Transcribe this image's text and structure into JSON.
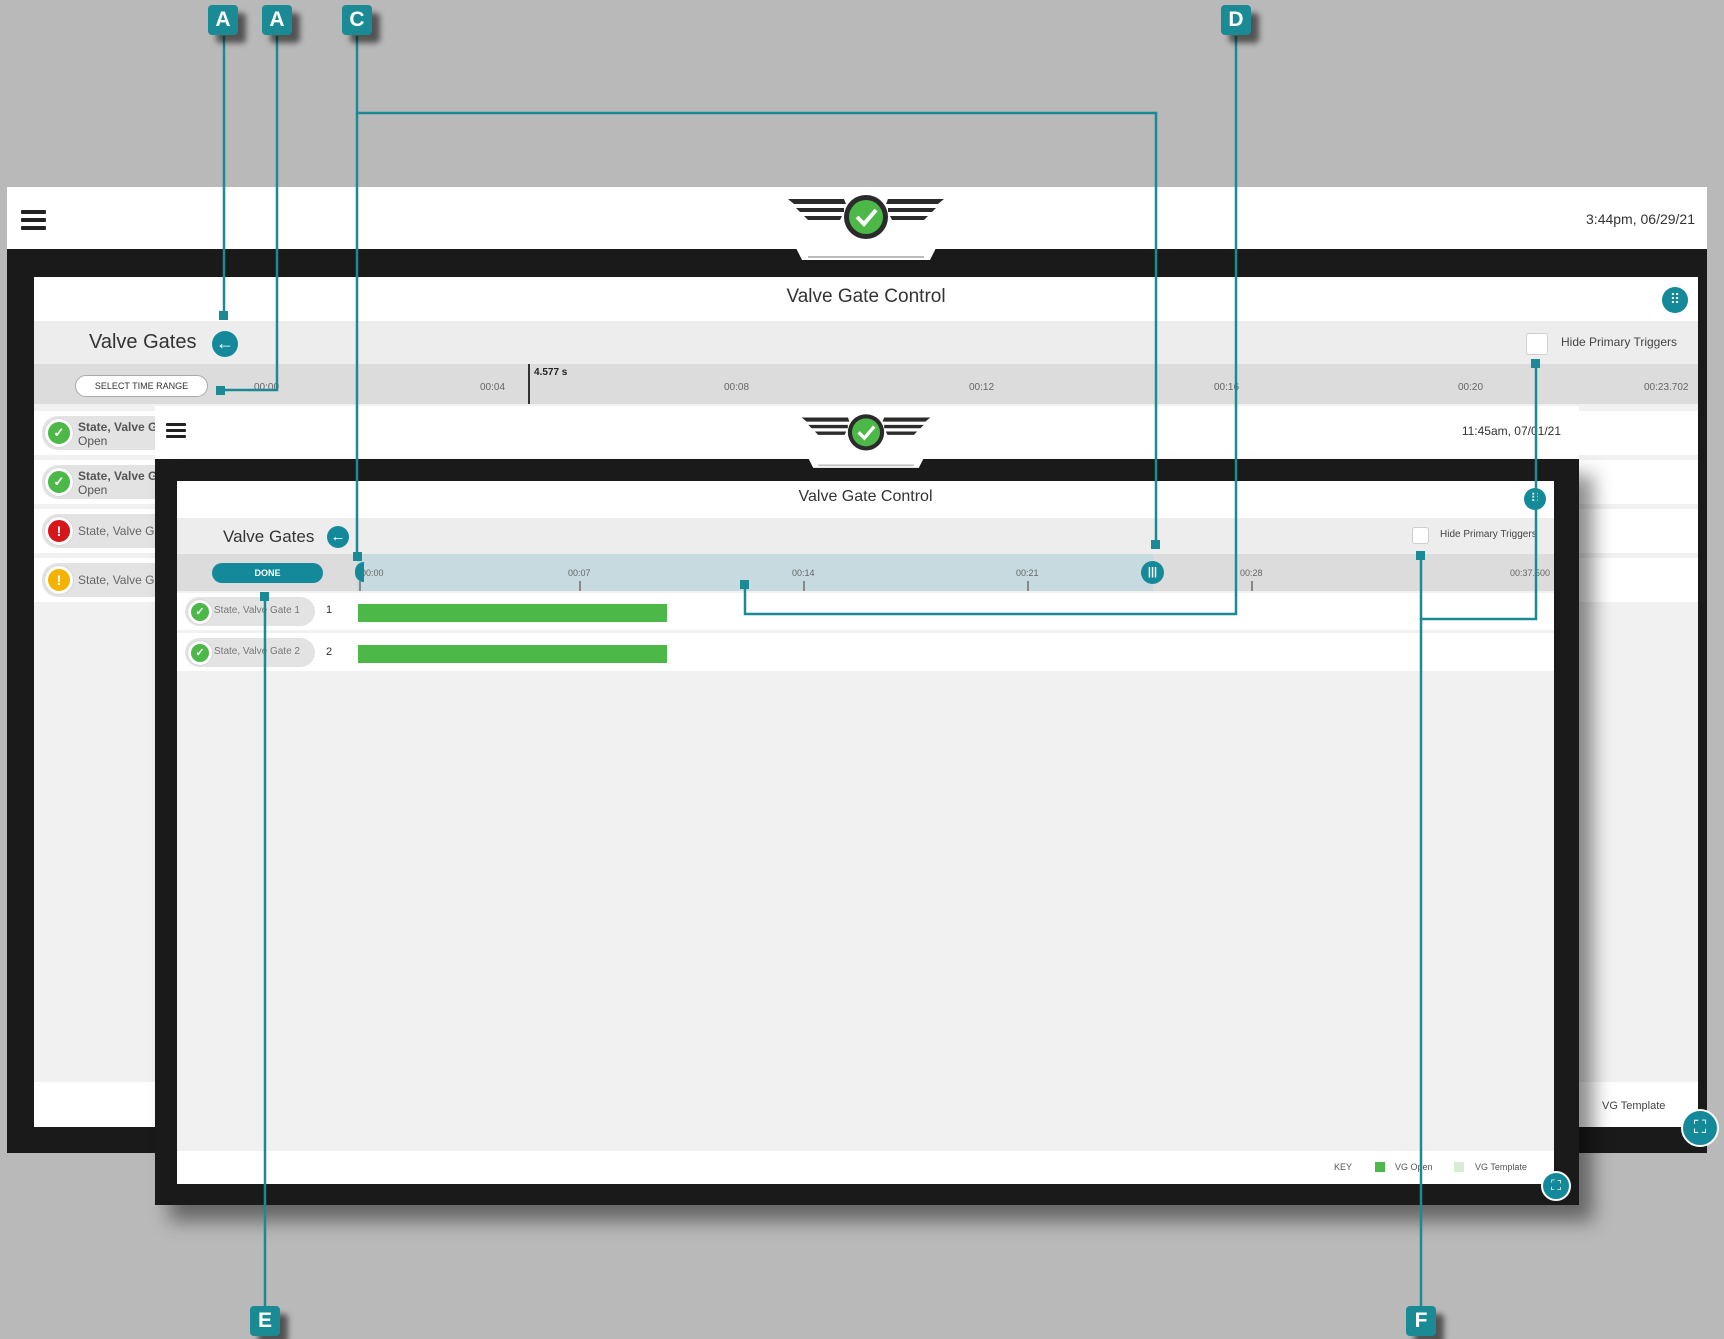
{
  "callouts": {
    "a1": "A",
    "a2": "A",
    "c": "C",
    "d": "D",
    "e": "E",
    "f": "F"
  },
  "back": {
    "datetime": "3:44pm, 06/29/21",
    "panel_title": "Valve Gate Control",
    "section_title": "Valve Gates",
    "hide_triggers_label": "Hide Primary Triggers",
    "select_time_range": "SELECT TIME RANGE",
    "cursor_time": "4.577 s",
    "ticks": [
      "00:00",
      "00:04",
      "00:08",
      "00:12",
      "00:16",
      "00:20",
      "00:23.702"
    ],
    "rows": [
      {
        "title": "State, Valve G",
        "sub": "Open",
        "status": "ok"
      },
      {
        "title": "State, Valve G",
        "sub": "Open",
        "status": "ok"
      },
      {
        "title": "State, Valve G",
        "sub": "",
        "status": "error"
      },
      {
        "title": "State, Valve G",
        "sub": "",
        "status": "warning"
      }
    ],
    "legend_template": "VG Template"
  },
  "front": {
    "datetime": "11:45am, 07/01/21",
    "panel_title": "Valve Gate Control",
    "section_title": "Valve Gates",
    "done_label": "DONE",
    "hide_triggers_label": "Hide Primary Triggers",
    "ticks": [
      "00:00",
      "00:07",
      "00:14",
      "00:21",
      "00:28",
      "00:37.500"
    ],
    "rows": [
      {
        "label": "State, Valve Gate 1",
        "num": "1",
        "status": "ok",
        "open_fraction_of_range": 0.39
      },
      {
        "label": "State, Valve Gate 2",
        "num": "2",
        "status": "ok",
        "open_fraction_of_range": 0.39
      }
    ],
    "key_label": "KEY",
    "legend_open": "VG Open",
    "legend_template": "VG Template"
  },
  "colors": {
    "teal": "#14899a",
    "green": "#4cb848",
    "red": "#d6161b",
    "amber": "#f5b301"
  }
}
